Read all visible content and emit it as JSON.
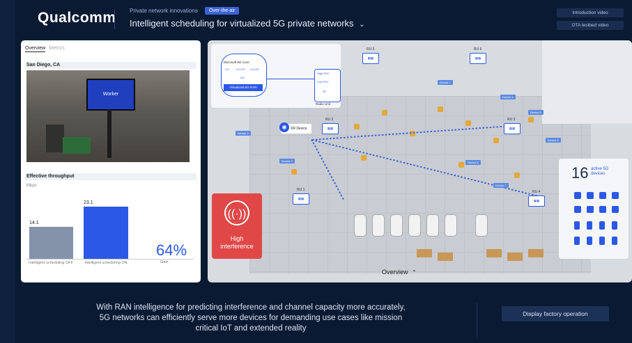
{
  "header": {
    "logo": "Qualcomm",
    "breadcrumb": "Private network innovations",
    "chip": "Over-the-air",
    "title": "Intelligent scheduling for virtualized 5G private networks",
    "title_chevron": "⌄",
    "intro_video_label": "Introduction video",
    "ota_video_label": "OTA testbed video"
  },
  "left_panel": {
    "tabs": [
      "Overview",
      "Metrics"
    ],
    "location": "San Diego, CA",
    "video_label": "Worker",
    "throughput_title": "Effective throughput",
    "units": "Mbps",
    "bars": [
      {
        "label": "Intelligent scheduling OFF",
        "value": "14.1"
      },
      {
        "label": "Intelligent scheduling ON",
        "value": "23.1"
      }
    ],
    "gain_value": "64%",
    "gain_label": "Gain"
  },
  "map": {
    "core_title": "Microsoft 5G Core",
    "core_items": [
      "CU",
      "CU-CP",
      "CU-UP",
      "DU"
    ],
    "vran_label": "Virtualized 5G RAN",
    "radio_items": [
      "High PHY",
      "Low PHY",
      "RF"
    ],
    "radio_unit_label": "Radio Unit",
    "xr_device": "XR Device",
    "ru_labels": [
      "RU 1",
      "RU 2",
      "RU 3",
      "RU 4",
      "RU 5",
      "RU 6"
    ],
    "interference_label": "High interference",
    "active_count": "16",
    "active_label": "active 5G devices",
    "device_tags": [
      "Device 1",
      "Device 2",
      "Device 3",
      "Device 4",
      "Device 5",
      "Device 6",
      "Device 7",
      "Device 8"
    ],
    "overview_label": "Overview",
    "overview_chevron": "⌃"
  },
  "footer": {
    "caption_line1": "With RAN intelligence for predicting interference and channel capacity more accurately,",
    "caption_line2": "5G networks can efficiently serve more devices for demanding use cases like mission",
    "caption_line3": "critical IoT and extended reality",
    "display_button": "Display factory operation"
  },
  "colors": {
    "background": "#0b1a33",
    "accent": "#2b58e6",
    "bar_off": "#8493aa",
    "interference": "#e04848"
  }
}
